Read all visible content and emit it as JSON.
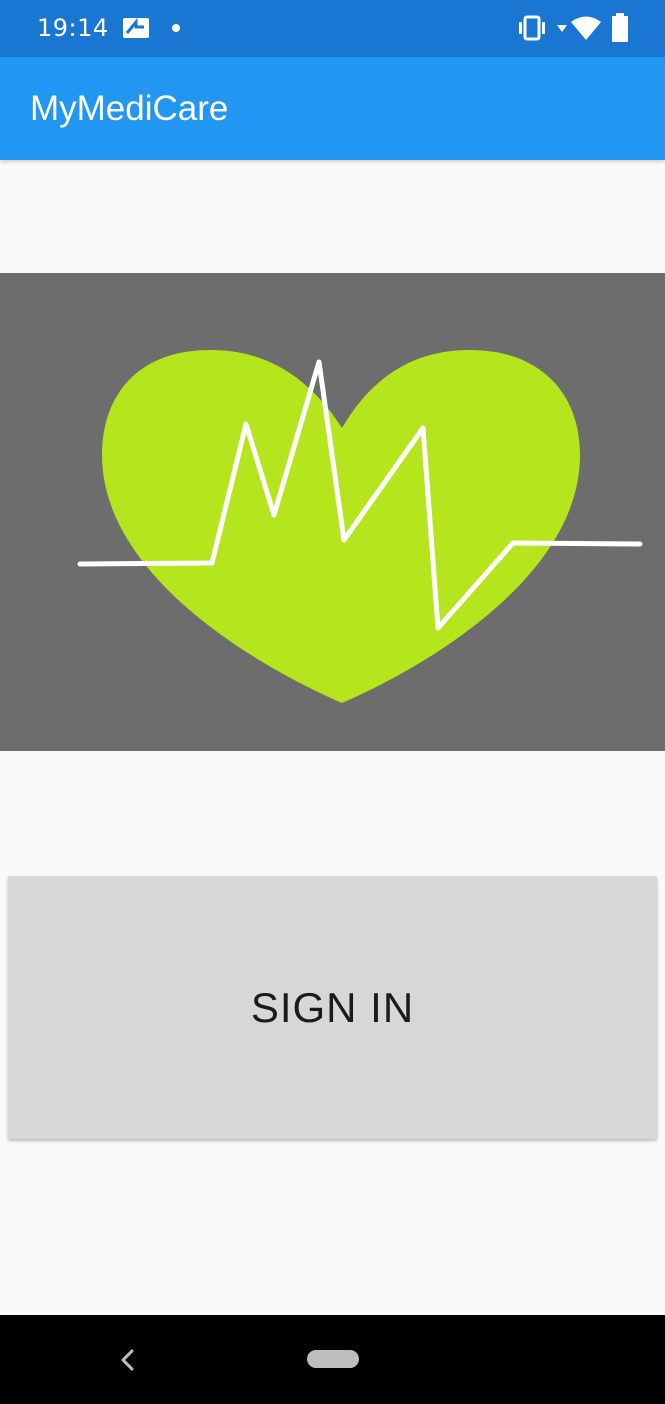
{
  "status_bar": {
    "time": "19:14",
    "icons": [
      "notification-icon",
      "dot-icon",
      "vibrate-icon",
      "data-arrows-icon",
      "wifi-icon",
      "battery-icon"
    ]
  },
  "app_bar": {
    "title": "MyMediCare"
  },
  "banner": {
    "icon": "heart-pulse-icon",
    "colors": {
      "background": "#6d6d6d",
      "heart": "#b5e61d",
      "pulse": "#ffffff"
    }
  },
  "main": {
    "sign_in_label": "SIGN IN"
  },
  "nav_bar": {
    "icons": [
      "back-icon",
      "home-pill-icon"
    ]
  },
  "colors": {
    "status_bar": "#1976d2",
    "app_bar": "#2196f3",
    "button": "#d6d7d7"
  }
}
